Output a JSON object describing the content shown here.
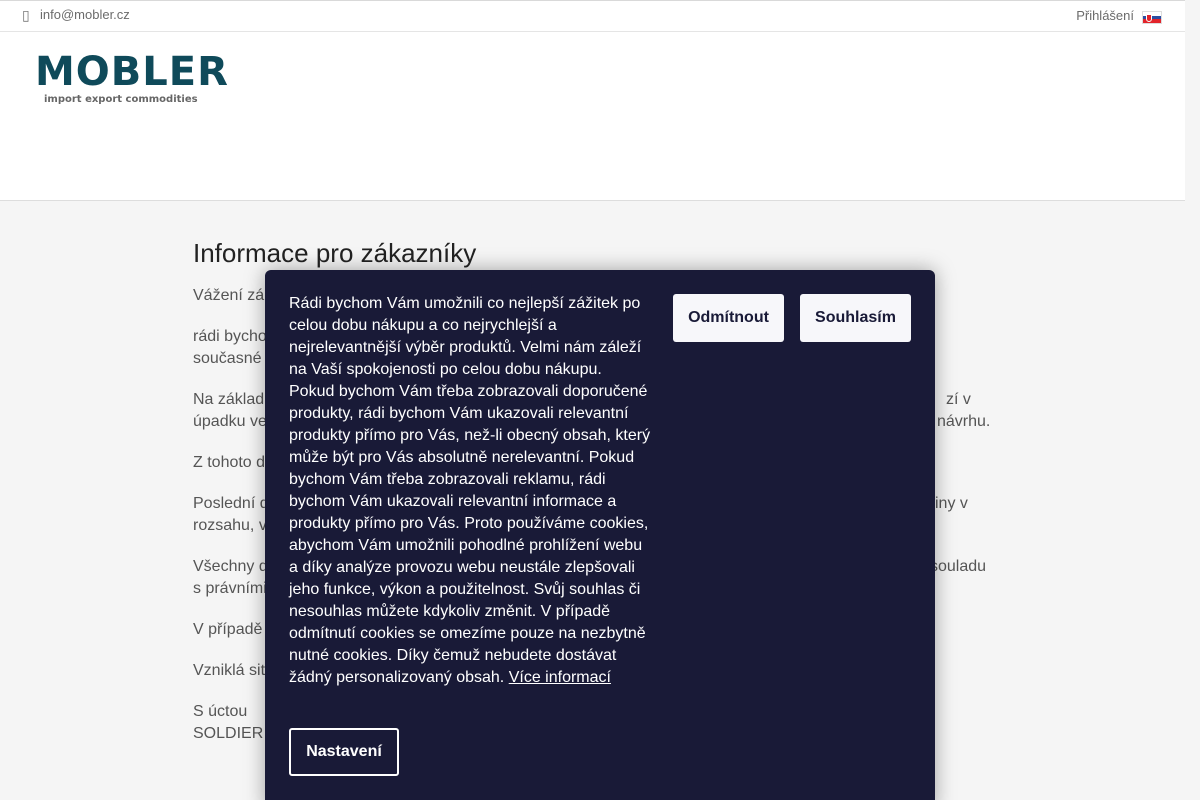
{
  "topbar": {
    "email": "info@mobler.cz",
    "login_label": "Přihlášení",
    "mail_icon": "envelope-icon",
    "flag_icon": "slovak-flag-icon"
  },
  "logo": {
    "wordmark": "MOBLER",
    "tagline": "import export commodities",
    "color": "#0f4a5a"
  },
  "content": {
    "title": "Informace pro zákazníky",
    "paragraphs": [
      "Vážení zá",
      "rádi bycho",
      "současné",
      "Na základ",
      "úpadku ve",
      "Z tohoto d",
      "Poslední d",
      "rozsahu, v",
      "Všechny d",
      "s právními",
      "V případě",
      "Vzniklá sit",
      "S úctou",
      "SOLDIER"
    ],
    "right_fragments": [
      "zí v",
      "návrhu.",
      "iny v",
      "souladu"
    ]
  },
  "cookie": {
    "message": "Rádi bychom Vám umožnili co nejlepší zážitek po celou dobu nákupu a co nejrychlejší a nejrelevantnější výběr produktů. Velmi nám záleží na Vaší spokojenosti po celou dobu nákupu. Pokud bychom Vám třeba zobrazovali doporučené produkty, rádi bychom Vám ukazovali relevantní produkty přímo pro Vás, než-li obecný obsah, který může být pro Vás absolutně nerelevantní. Pokud bychom Vám třeba zobrazovali reklamu, rádi bychom Vám ukazovali relevantní informace a produkty přímo pro Vás. Proto používáme cookies, abychom Vám umožnili pohodlné prohlížení webu a díky analýze provozu webu neustále zlepšovali jeho funkce, výkon a použitelnost. Svůj souhlas či nesouhlas můžete kdykoliv změnit. V případě odmítnutí cookies se omezíme pouze na nezbytně nutné cookies. Díky čemuž nebudete dostávat žádný personalizovaný obsah.",
    "more_info_label": "Více informací",
    "reject_label": "Odmítnout",
    "accept_label": "Souhlasím",
    "settings_label": "Nastavení",
    "background": "#191a37"
  }
}
